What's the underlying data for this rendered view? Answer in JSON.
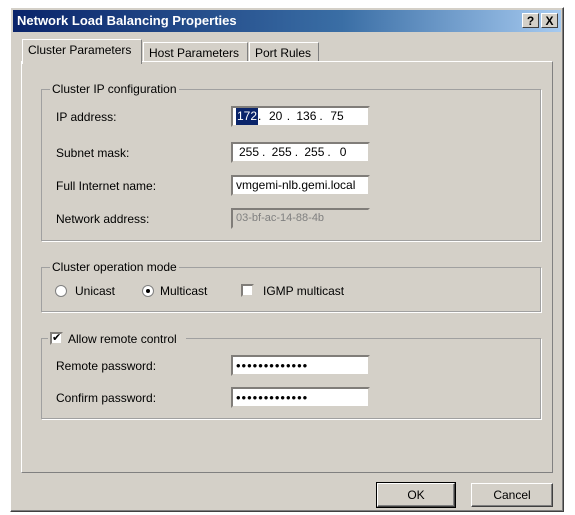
{
  "window": {
    "title": "Network Load Balancing Properties"
  },
  "titlebar_buttons": {
    "help": "?",
    "close": "X"
  },
  "tabs": [
    {
      "label": "Cluster Parameters"
    },
    {
      "label": "Host Parameters"
    },
    {
      "label": "Port Rules"
    }
  ],
  "cluster_ip": {
    "group_label": "Cluster IP configuration",
    "ip_label": "IP address:",
    "ip_octets": [
      "172",
      "20",
      "136",
      "75"
    ],
    "subnet_label": "Subnet mask:",
    "subnet_octets": [
      "255",
      "255",
      "255",
      "0"
    ],
    "internet_name_label": "Full Internet name:",
    "internet_name_value": "vmgemi-nlb.gemi.local",
    "network_address_label": "Network address:",
    "network_address_value": "03-bf-ac-14-88-4b"
  },
  "operation_mode": {
    "group_label": "Cluster operation mode",
    "unicast_label": "Unicast",
    "multicast_label": "Multicast",
    "igmp_label": "IGMP multicast",
    "selected": "Multicast"
  },
  "remote_control": {
    "checkbox_label": "Allow remote control",
    "checked": true,
    "password_label": "Remote password:",
    "password_value": "•••••••••••••",
    "confirm_label": "Confirm password:",
    "confirm_value": "•••••••••••••"
  },
  "buttons": {
    "ok": "OK",
    "cancel": "Cancel"
  }
}
